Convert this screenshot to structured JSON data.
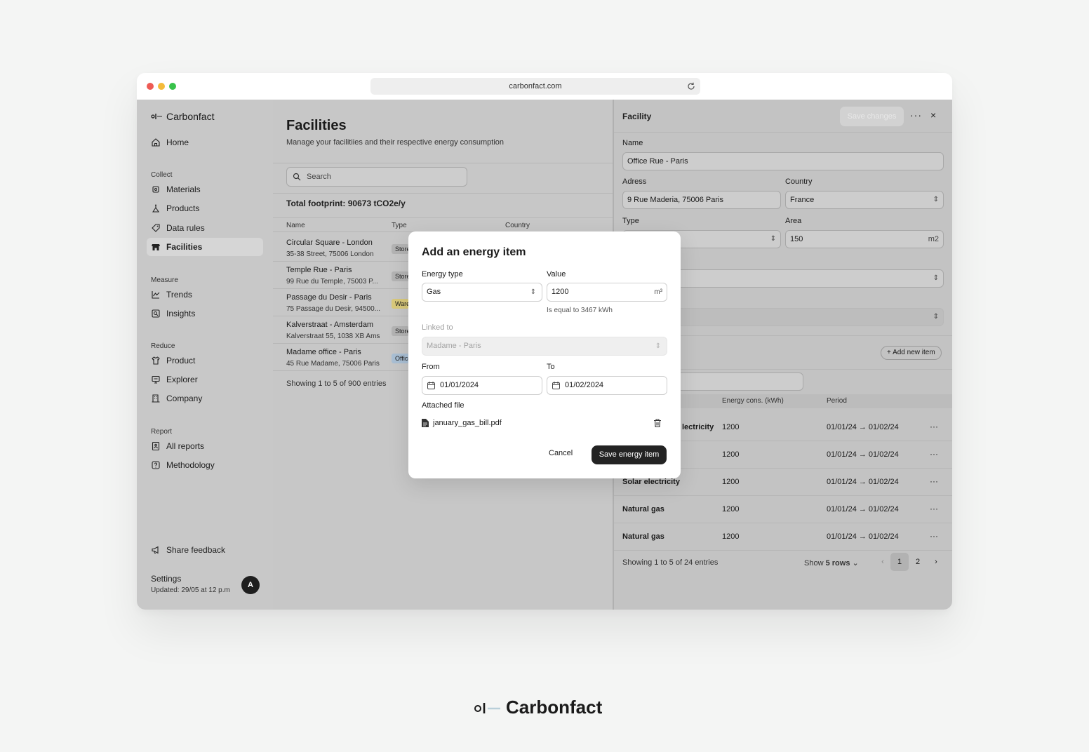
{
  "browser": {
    "url": "carbonfact.com"
  },
  "sidebar": {
    "brand": "Carbonfact",
    "home": "Home",
    "sections": {
      "collect": "Collect",
      "measure": "Measure",
      "reduce": "Reduce",
      "report": "Report"
    },
    "items": {
      "materials": "Materials",
      "products": "Products",
      "data_rules": "Data rules",
      "facilities": "Facilities",
      "trends": "Trends",
      "insights": "Insights",
      "product": "Product",
      "explorer": "Explorer",
      "company": "Company",
      "all_reports": "All reports",
      "methodology": "Methodology"
    },
    "share_feedback": "Share feedback",
    "settings": "Settings",
    "updated": "Updated: 29/05 at 12 p.m",
    "avatar": "A"
  },
  "main": {
    "title": "Facilities",
    "subtitle": "Manage your facilitiies and their respective energy consumption",
    "search_placeholder": "Search",
    "total_footprint": "Total footprint: 90673 tCO2e/y",
    "columns": {
      "name": "Name",
      "type": "Type",
      "country": "Country"
    },
    "rows": [
      {
        "name": "Circular Square - London",
        "address": "35-38 Street, 75006 London",
        "type": "Store"
      },
      {
        "name": "Temple Rue - Paris",
        "address": "99 Rue du Temple, 75003 P...",
        "type": "Store"
      },
      {
        "name": "Passage du Desir - Paris",
        "address": "75 Passage du Desir, 94500...",
        "type": "Warehouse"
      },
      {
        "name": "Kalverstraat - Amsterdam",
        "address": "Kalverstraat 55, 1038 XB Ams",
        "type": "Store"
      },
      {
        "name": "Madame office - Paris",
        "address": "45 Rue Madame, 75006 Paris",
        "type": "Office"
      }
    ],
    "showing": "Showing 1 to 5 of 900 entries"
  },
  "panel": {
    "title": "Facility",
    "save_changes": "Save changes",
    "more": "···",
    "close": "×",
    "name_label": "Name",
    "name_value": "Office Rue - Paris",
    "address_label": "Adress",
    "address_value": "9 Rue Maderia, 75006 Paris",
    "country_label": "Country",
    "country_value": "France",
    "type_label": "Type",
    "area_label": "Area",
    "area_value": "150",
    "area_unit": "m2",
    "add_new_item": "+ Add new item",
    "columns": {
      "energy": "Energy cons. (kWh)",
      "period": "Period"
    },
    "rows": [
      {
        "type": "lectricity",
        "energy": "1200",
        "period": "01/01/24 → 01/02/24"
      },
      {
        "type": "",
        "energy": "1200",
        "period": "01/01/24 → 01/02/24"
      },
      {
        "type": "Solar electricity",
        "energy": "1200",
        "period": "01/01/24 → 01/02/24"
      },
      {
        "type": "Natural gas",
        "energy": "1200",
        "period": "01/01/24 → 01/02/24"
      },
      {
        "type": "Natural gas",
        "energy": "1200",
        "period": "01/01/24 → 01/02/24"
      }
    ],
    "showing": "Showing 1 to 5 of 24 entries",
    "show_label": "Show",
    "show_rows": "5 rows",
    "pages": [
      "1",
      "2"
    ]
  },
  "modal": {
    "title": "Add an energy item",
    "energy_type_label": "Energy type",
    "energy_type_value": "Gas",
    "value_label": "Value",
    "value": "1200",
    "value_unit": "m³",
    "hint": "Is equal to 3467 kWh",
    "linked_label": "Linked to",
    "linked_value": "Madame - Paris",
    "from_label": "From",
    "from_value": "01/01/2024",
    "to_label": "To",
    "to_value": "01/02/2024",
    "attached_label": "Attached file",
    "file_name": "january_gas_bill.pdf",
    "cancel": "Cancel",
    "save": "Save energy item"
  },
  "footer_brand": "Carbonfact",
  "colors": {
    "accent_dark": "#232323",
    "tag_store": "#b3b3b3",
    "tag_warehouse": "#d9c97a",
    "tag_office": "#a9bfd4"
  }
}
